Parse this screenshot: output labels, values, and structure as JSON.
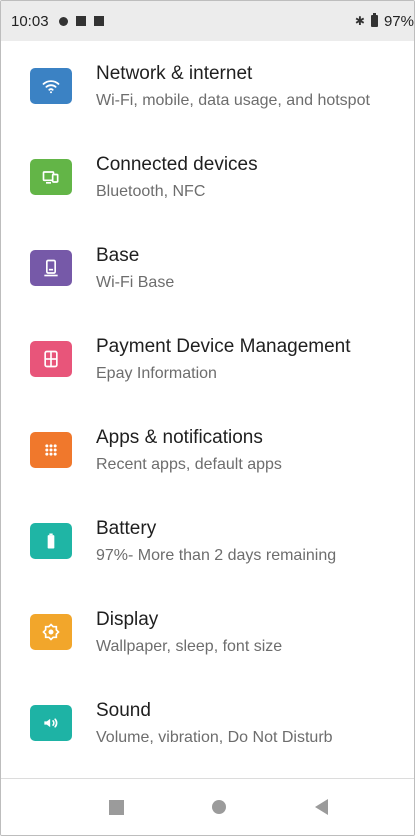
{
  "status_bar": {
    "time": "10:03",
    "battery_text": "97%",
    "notification_icons": [
      "dot-icon",
      "square-icon",
      "square-icon"
    ]
  },
  "settings": {
    "items": [
      {
        "title": "Network & internet",
        "subtitle": "Wi-Fi, mobile, data usage, and hotspot",
        "icon": "wifi-icon",
        "color": "#3b82c4"
      },
      {
        "title": "Connected devices",
        "subtitle": "Bluetooth, NFC",
        "icon": "devices-icon",
        "color": "#63b547"
      },
      {
        "title": "Base",
        "subtitle": "Wi-Fi Base",
        "icon": "base-icon",
        "color": "#7659a8"
      },
      {
        "title": "Payment Device Management",
        "subtitle": "Epay Information",
        "icon": "payment-icon",
        "color": "#e8557a"
      },
      {
        "title": "Apps & notifications",
        "subtitle": "Recent apps, default apps",
        "icon": "apps-icon",
        "color": "#f0782c"
      },
      {
        "title": "Battery",
        "subtitle": "97%- More than 2 days remaining",
        "icon": "battery-icon",
        "color": "#1fb5a5"
      },
      {
        "title": "Display",
        "subtitle": "Wallpaper, sleep, font size",
        "icon": "display-icon",
        "color": "#f2a62b"
      },
      {
        "title": "Sound",
        "subtitle": "Volume, vibration, Do Not Disturb",
        "icon": "sound-icon",
        "color": "#1eb3a5"
      }
    ]
  },
  "nav_bar": {
    "buttons": [
      "recents-button",
      "home-button",
      "back-button"
    ]
  }
}
